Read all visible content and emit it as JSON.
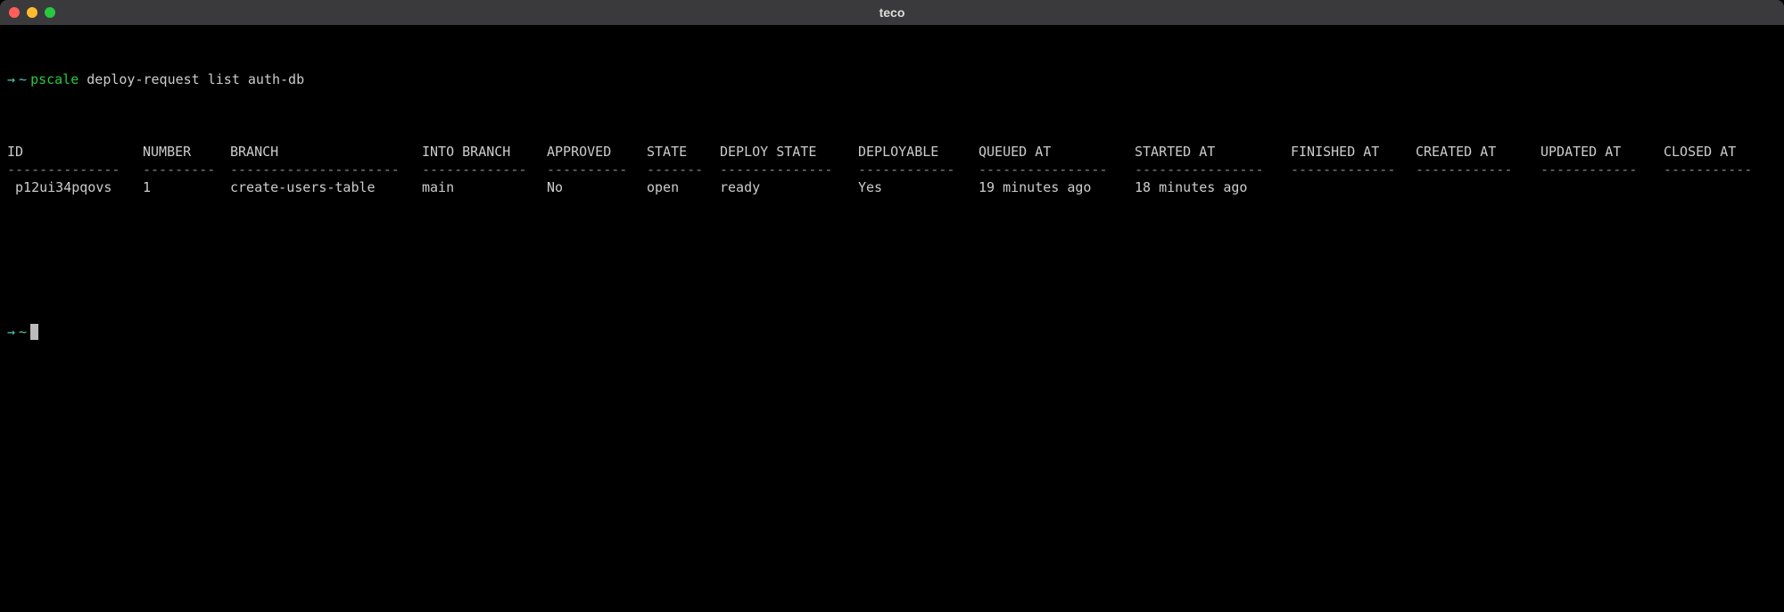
{
  "window": {
    "title": "teco"
  },
  "prompt": {
    "arrow": "→",
    "tilde": "~",
    "command": "pscale",
    "args": "deploy-request list auth-db"
  },
  "table": {
    "headers": {
      "id": "ID",
      "number": "NUMBER",
      "branch": "BRANCH",
      "into_branch": "INTO BRANCH",
      "approved": "APPROVED",
      "state": "STATE",
      "deploy_state": "DEPLOY STATE",
      "deployable": "DEPLOYABLE",
      "queued_at": "QUEUED AT",
      "started_at": "STARTED AT",
      "finished_at": "FINISHED AT",
      "created_at": "CREATED AT",
      "updated_at": "UPDATED AT",
      "closed_at": "CLOSED AT"
    },
    "separators": {
      "id": "--------------",
      "number": "---------",
      "branch": "---------------------",
      "into_branch": "-------------",
      "approved": "----------",
      "state": "-------",
      "deploy_state": "--------------",
      "deployable": "------------",
      "queued_at": "----------------",
      "started_at": "----------------",
      "finished_at": "-------------",
      "created_at": "------------",
      "updated_at": "------------",
      "closed_at": "-----------"
    },
    "rows": [
      {
        "id": " p12ui34pqovs",
        "number": "1",
        "branch": "create-users-table",
        "into_branch": "main",
        "approved": "No",
        "state": "open",
        "deploy_state": "ready",
        "deployable": "Yes",
        "queued_at": "19 minutes ago",
        "started_at": "18 minutes ago",
        "finished_at": "",
        "created_at": "",
        "updated_at": "",
        "closed_at": ""
      }
    ]
  },
  "prompt2": {
    "arrow": "→",
    "tilde": "~"
  }
}
